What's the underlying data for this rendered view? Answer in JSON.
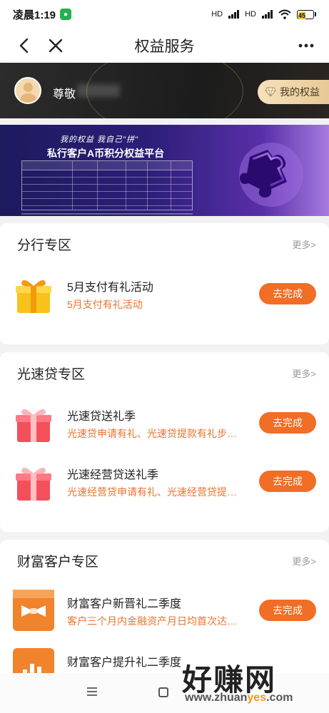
{
  "status_bar": {
    "time": "凌晨1:19",
    "network_1": "HD",
    "network_2": "HD",
    "battery": "45"
  },
  "nav": {
    "title": "权益服务"
  },
  "user": {
    "greeting": "尊敬",
    "my_rights_label": "我的权益"
  },
  "banner": {
    "tagline": "我的权益  我自己\"拼\"",
    "title": "私行客户A币积分权益平台"
  },
  "sections": {
    "branch": {
      "title": "分行专区",
      "more": "更多>",
      "items": [
        {
          "title": "5月支付有礼活动",
          "subtitle": "5月支付有礼活动",
          "button": "去完成",
          "icon": "gift-gold-icon"
        }
      ]
    },
    "loan": {
      "title": "光速贷专区",
      "more": "更多>",
      "items": [
        {
          "title": "光速贷送礼季",
          "subtitle": "光速贷申请有礼、光速贷提款有礼步…",
          "button": "去完成",
          "icon": "gift-red-icon"
        },
        {
          "title": "光速经营贷送礼季",
          "subtitle": "光速经营贷申请有礼、光速经营贷提…",
          "button": "去完成",
          "icon": "gift-red-icon"
        }
      ]
    },
    "wealth": {
      "title": "财富客户专区",
      "more": "更多>",
      "items": [
        {
          "title": "财富客户新晋礼二季度",
          "subtitle": "客户三个月内金融资产月日均首次达…",
          "button": "去完成",
          "icon": "bow-badge-icon"
        },
        {
          "title": "财富客户提升礼二季度",
          "subtitle": "",
          "button": "",
          "icon": "bar-badge-icon"
        }
      ]
    }
  },
  "watermark": {
    "text": "好赚网",
    "url_prefix": "www.zhuan",
    "url_highlight": "yes",
    "url_suffix": ".com"
  },
  "colors": {
    "accent": "#f26d25",
    "subtitle": "#e8742e",
    "gold": "#e8c995"
  }
}
